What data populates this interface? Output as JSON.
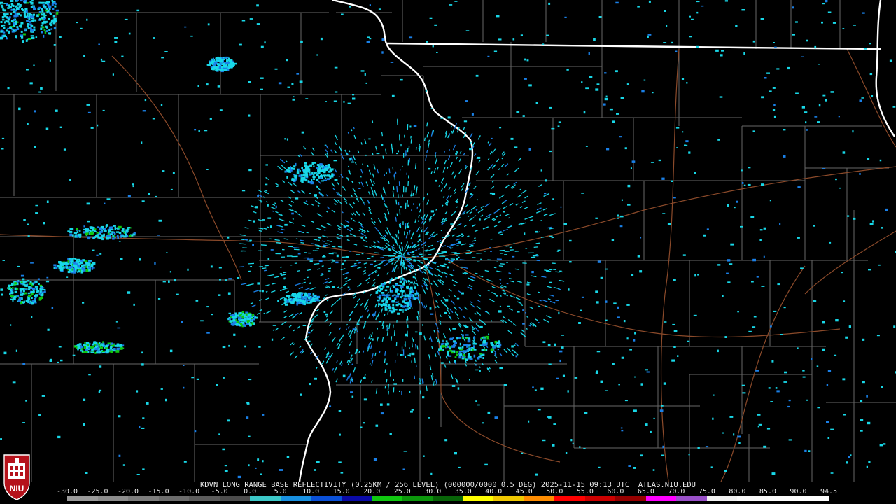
{
  "header": {
    "title": "KDVN LONG RANGE BASE REFLECTIVITY (0.25KM / 256 LEVEL) (000000/0000 0.5 DEG) 2025-11-15 09:13 UTC  ATLAS.NIU.EDU"
  },
  "colorbar": {
    "labels": [
      "-30.0",
      "-25.0",
      "-20.0",
      "-15.0",
      "-10.0",
      "-5.0",
      "0.0",
      "5.0",
      "10.0",
      "15.0",
      "20.0",
      "25.0",
      "30.0",
      "35.0",
      "40.0",
      "45.0",
      "50.0",
      "55.0",
      "60.0",
      "65.0",
      "70.0",
      "75.0",
      "80.0",
      "85.0",
      "90.0",
      "94.5"
    ],
    "colors": [
      "#9a9a9a",
      "#8c8c8c",
      "#7c7c7c",
      "#6c6c6c",
      "#5c5c5c",
      "#4c4c4c",
      "#3cc8c8",
      "#1890e0",
      "#0a50d8",
      "#0a0aa8",
      "#10c810",
      "#0c960c",
      "#086408",
      "#ffff00",
      "#f0c800",
      "#ff8c00",
      "#ff0000",
      "#cc0000",
      "#960000",
      "#ff00ff",
      "#9950c8",
      "#f0f0f0",
      "#f8f8f8",
      "#fafafa",
      "#fcfcfc"
    ],
    "label_color": "#e8e8e8"
  },
  "logo": {
    "text": "NIU",
    "color": "#b5121b"
  },
  "map_colors": {
    "background": "#000000",
    "county_lines": "#7a7a7a",
    "state_lines": "#ffffff",
    "roads": "#8b4a2a",
    "echo_light": "#18d8e8",
    "echo_medium": "#1a80e8",
    "echo_heavy": "#10c810"
  }
}
